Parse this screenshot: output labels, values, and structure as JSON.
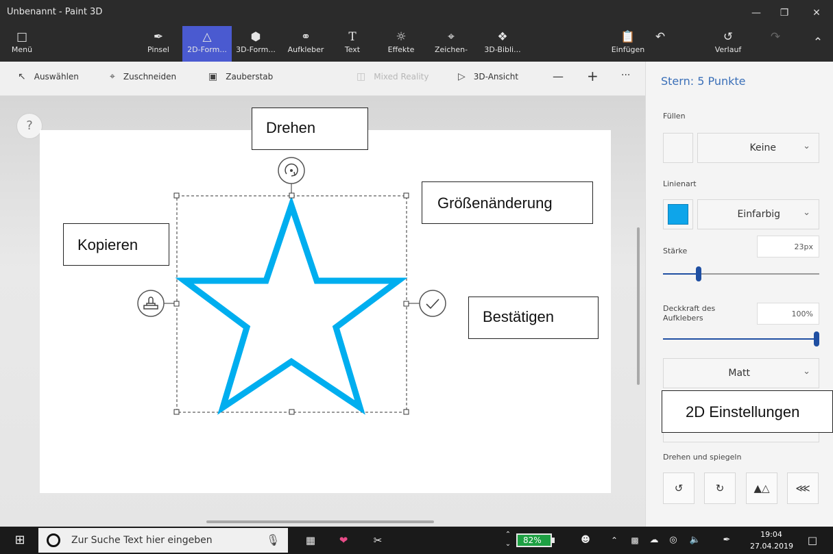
{
  "window": {
    "title": "Unbenannt - Paint 3D",
    "minimize_icon": "minimize-icon",
    "maximize_icon": "restore-icon",
    "close_icon": "close-icon"
  },
  "ribbon": {
    "menu": {
      "label": "Menü",
      "icon": "folder-icon"
    },
    "tools": [
      {
        "label": "Pinsel",
        "icon": "brush-icon"
      },
      {
        "label": "2D-Form...",
        "icon": "2d-shapes-icon",
        "active": true
      },
      {
        "label": "3D-Form...",
        "icon": "3d-shapes-icon"
      },
      {
        "label": "Aufkleber",
        "icon": "sticker-icon"
      },
      {
        "label": "Text",
        "icon": "text-icon"
      },
      {
        "label": "Effekte",
        "icon": "effects-icon"
      },
      {
        "label": "Zeichen-",
        "icon": "canvas-icon"
      },
      {
        "label": "3D-Bibli...",
        "icon": "3d-library-icon"
      }
    ],
    "paste": {
      "label": "Einfügen",
      "icon": "paste-icon"
    },
    "undo_icon": "undo-icon",
    "history": {
      "label": "Verlauf",
      "icon": "history-icon"
    },
    "redo_icon": "redo-icon",
    "collapse_icon": "chevron-up-icon"
  },
  "toolbar": {
    "select": "Auswählen",
    "crop": "Zuschneiden",
    "magic_select": "Zauberstab",
    "mixed_reality": "Mixed Reality",
    "view_3d": "3D-Ansicht",
    "zoom_out": "—",
    "zoom_in": "+",
    "more": "···"
  },
  "workspace": {
    "help": "?",
    "callouts": {
      "rotate": "Drehen",
      "resize": "Größenänderung",
      "copy": "Kopieren",
      "confirm": "Bestätigen",
      "settings_2d": "2D Einstellungen"
    },
    "star_color": "#00aeef"
  },
  "panel": {
    "title": "Stern: 5 Punkte",
    "fill_label": "Füllen",
    "fill_value": "Keine",
    "line_label": "Linienart",
    "line_value": "Einfarbig",
    "line_color": "#0ea5ea",
    "thickness_label": "Stärke",
    "thickness_value": "23px",
    "thickness_fraction": 0.23,
    "opacity_label": "Deckkraft des Aufklebers",
    "opacity_value": "100%",
    "opacity_fraction": 1.0,
    "finish_value": "Matt",
    "rotate_label": "Drehen und spiegeln",
    "accent": "#3a6fb8"
  },
  "taskbar": {
    "search_placeholder": "Zur Suche Text hier eingeben",
    "battery": "82%",
    "time": "19:04",
    "date": "27.04.2019"
  }
}
